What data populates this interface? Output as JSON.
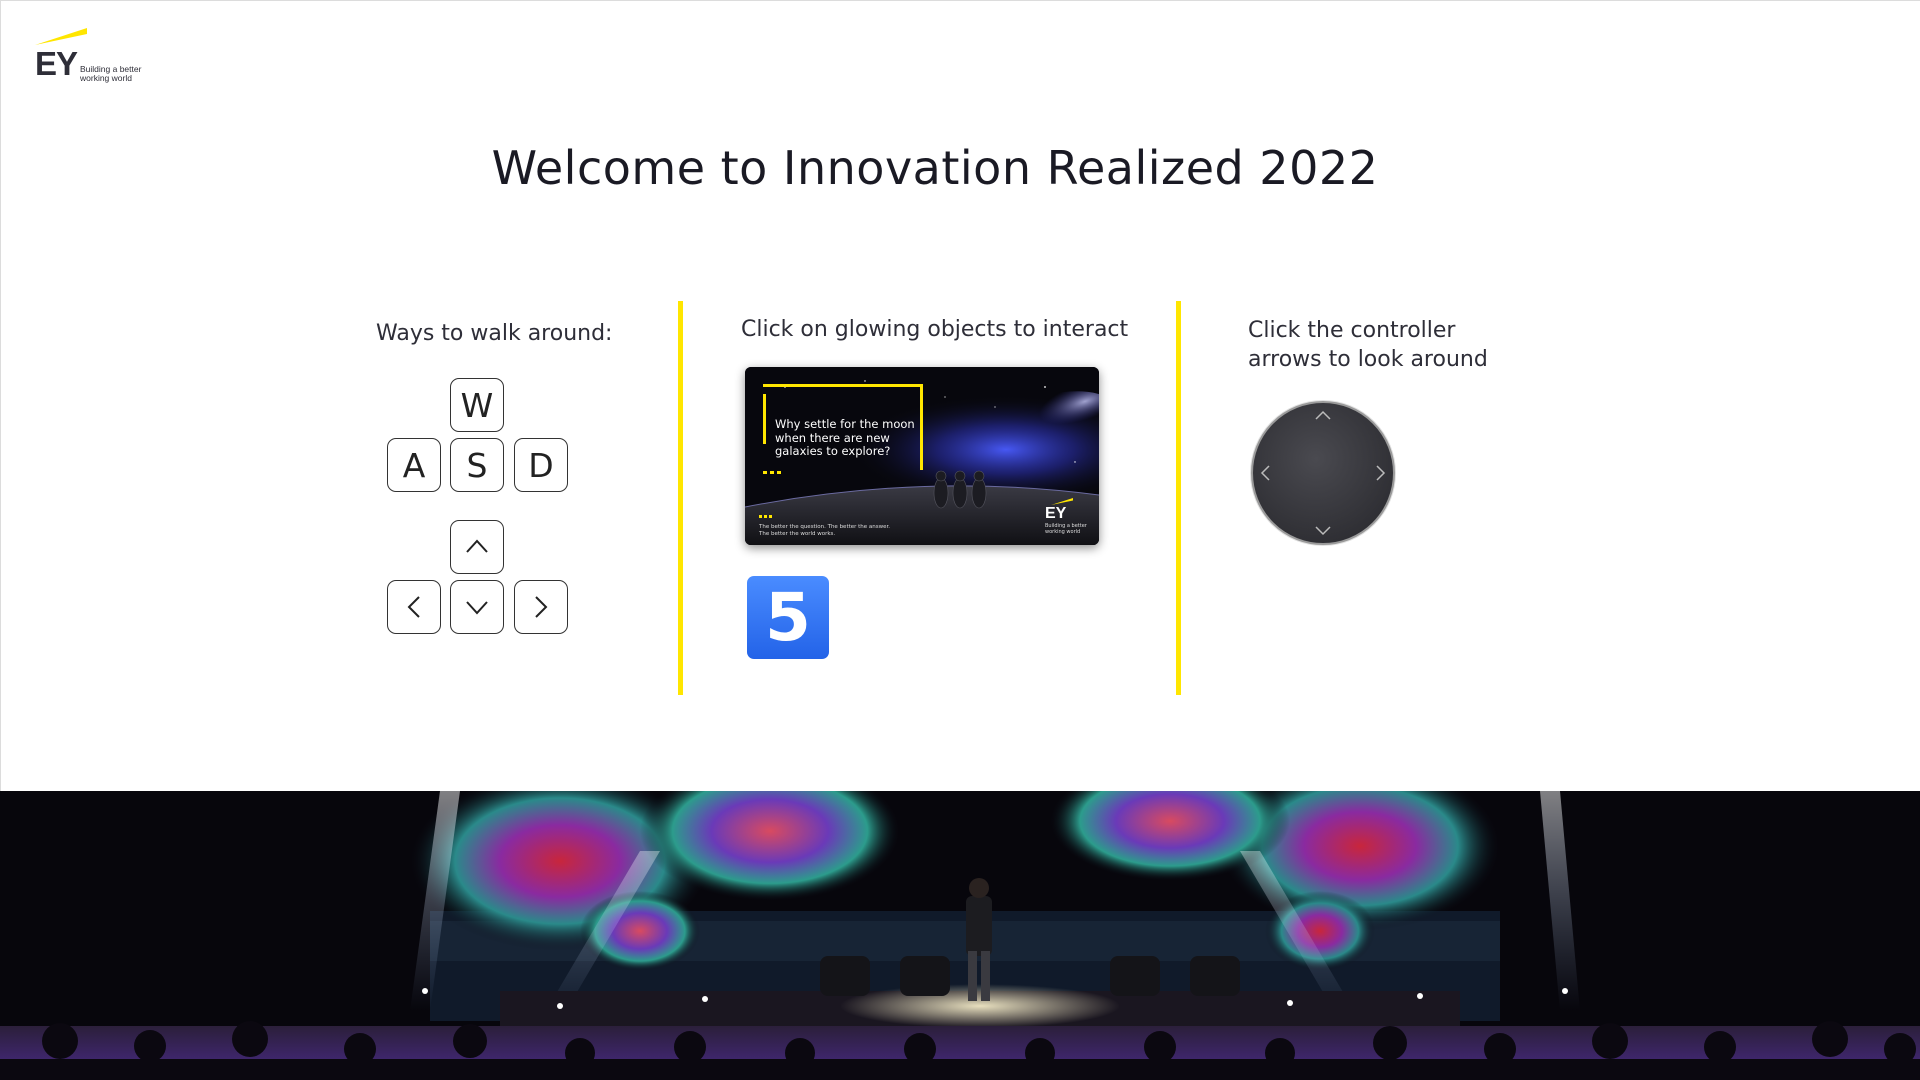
{
  "logo": {
    "wordmark": "EY",
    "tagline": "Building a better working world"
  },
  "title": "Welcome to Innovation Realized 2022",
  "walk": {
    "heading": "Ways to walk around:",
    "keys": [
      "W",
      "A",
      "S",
      "D"
    ],
    "arrow_keys": [
      "up-arrow-icon",
      "left-arrow-icon",
      "down-arrow-icon",
      "right-arrow-icon"
    ]
  },
  "interact": {
    "heading": "Click on glowing objects to interact",
    "poster": {
      "headline": "Why settle for the moon when there are new galaxies to explore?",
      "footer": "The better the question. The better the answer. The better the world works.",
      "logo_wordmark": "EY",
      "logo_tagline": "Building a better working world"
    },
    "badge_number": "5"
  },
  "look": {
    "heading_line1": "Click the controller",
    "heading_line2": "arrows to look around",
    "controller_icon": "joystick-controller-icon"
  },
  "colors": {
    "accent_yellow": "#ffe600",
    "text_dark": "#2e2e38",
    "badge_blue": "#2f7fff",
    "controller_dark": "#3a3a3f"
  }
}
